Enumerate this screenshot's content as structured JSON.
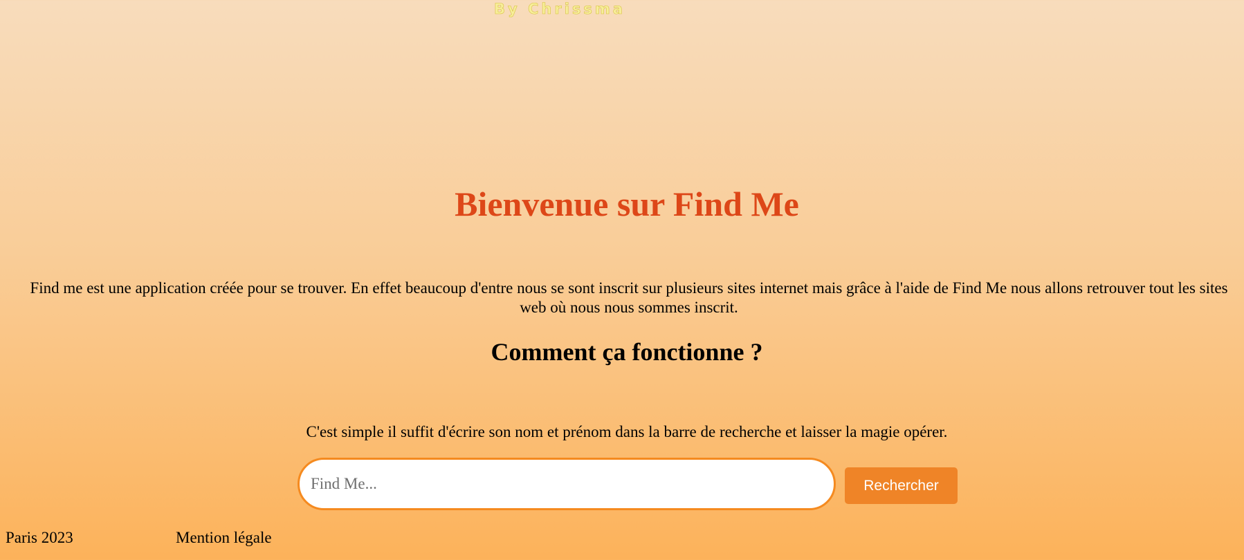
{
  "header": {
    "byline": "By Chrissma"
  },
  "hero": {
    "title": "Bienvenue sur Find Me",
    "intro": "Find me est une application créée pour se trouver. En effet beaucoup d'entre nous se sont inscrit sur plusieurs sites internet mais grâce à l'aide de Find Me nous allons retrouver tout les sites web où nous nous sommes inscrit."
  },
  "how_it_works": {
    "title": "Comment ça fonctionne ?",
    "text": "C'est simple il suffit d'écrire son nom et prénom dans la barre de recherche et laisser la magie opérer."
  },
  "search": {
    "placeholder": "Find Me...",
    "value": "",
    "button_label": "Rechercher"
  },
  "footer": {
    "location_year": "Paris 2023",
    "legal_link": "Mention légale"
  },
  "colors": {
    "title": "#dd4718",
    "accent": "#ef8427",
    "input_border": "#f58a1f",
    "gradient_top": "#f8dcbc",
    "gradient_bottom": "#fcb25a"
  }
}
